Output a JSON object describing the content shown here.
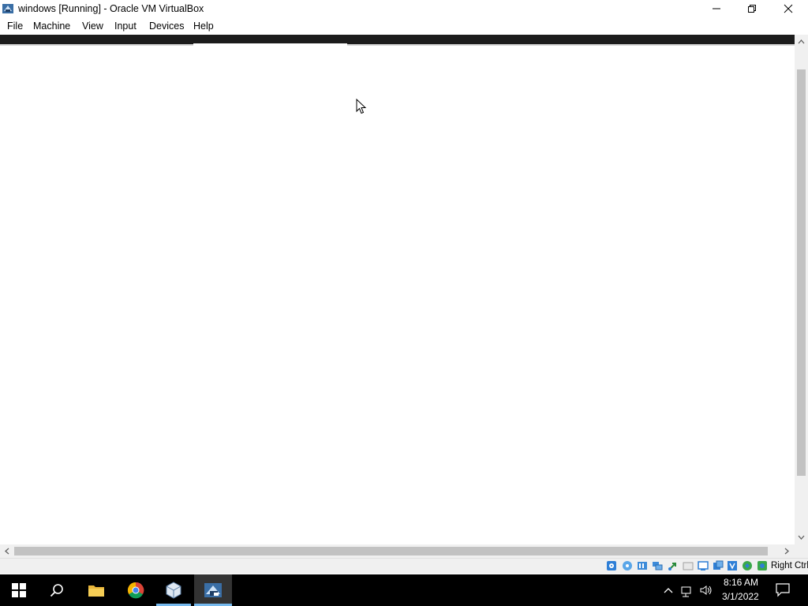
{
  "window": {
    "title": "windows [Running] - Oracle VM VirtualBox",
    "app_icon": "virtualbox-app-icon",
    "controls": [
      "minimize-icon",
      "restore-icon",
      "close-icon"
    ]
  },
  "menu": {
    "items": [
      "File",
      "Machine",
      "View",
      "Input",
      "Devices",
      "Help"
    ]
  },
  "statusbar": {
    "indicators": [
      "hard-disk-icon",
      "optical-disk-icon",
      "audio-icon",
      "network-icon",
      "usb-icon",
      "shared-folders-icon",
      "display-icon",
      "video-capture-icon",
      "cpu-icon",
      "mouse-integration-icon",
      "keyboard-icon"
    ],
    "host_key": "Right Ctrl"
  },
  "taskbar": {
    "buttons": [
      "start-icon",
      "search-icon",
      "file-explorer-icon",
      "chrome-icon",
      "virtualbox-icon",
      "vm-window-icon"
    ],
    "tray": [
      "chevron-up-icon",
      "network-icon",
      "volume-icon"
    ],
    "time": "8:16 AM",
    "date": "3/1/2022",
    "notifications": "action-center-icon",
    "accent_color": "#76b9ed"
  }
}
